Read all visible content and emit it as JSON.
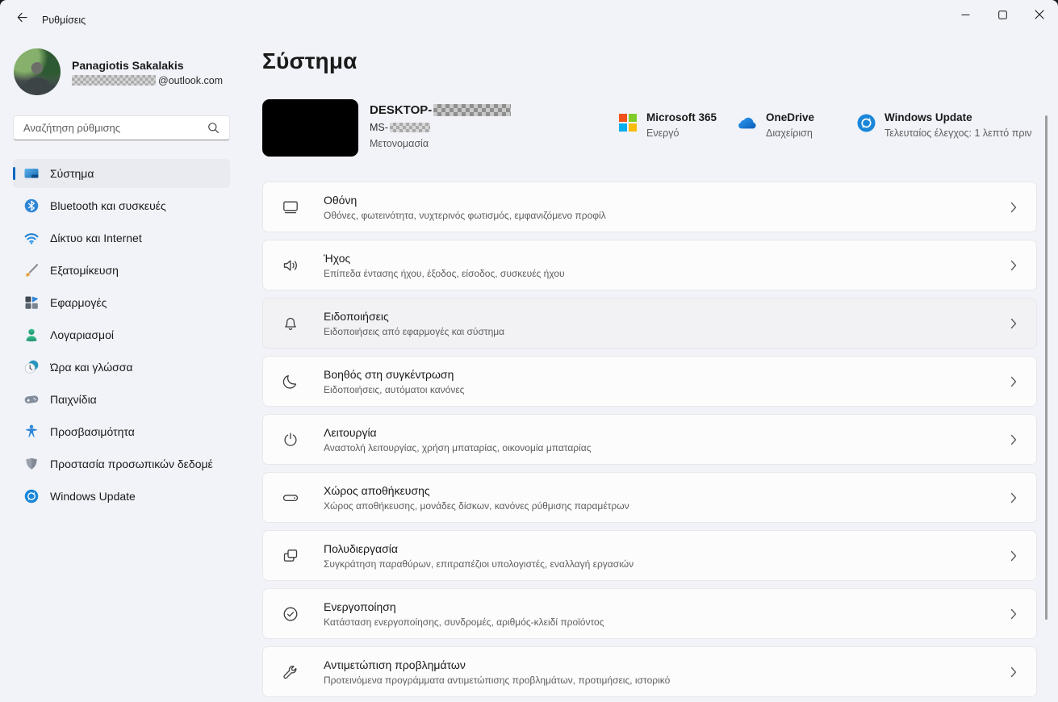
{
  "titlebar": {
    "title": "Ρυθμίσεις"
  },
  "profile": {
    "name": "Panagiotis Sakalakis",
    "email_suffix": "@outlook.com"
  },
  "search": {
    "placeholder": "Αναζήτηση ρύθμισης"
  },
  "sidebar": {
    "items": [
      {
        "label": "Σύστημα",
        "icon": "system-icon",
        "selected": true
      },
      {
        "label": "Bluetooth και συσκευές",
        "icon": "bluetooth-icon",
        "selected": false
      },
      {
        "label": "Δίκτυο και Internet",
        "icon": "network-icon",
        "selected": false
      },
      {
        "label": "Εξατομίκευση",
        "icon": "personalization-icon",
        "selected": false
      },
      {
        "label": "Εφαρμογές",
        "icon": "apps-icon",
        "selected": false
      },
      {
        "label": "Λογαριασμοί",
        "icon": "accounts-icon",
        "selected": false
      },
      {
        "label": "Ώρα και γλώσσα",
        "icon": "time-language-icon",
        "selected": false
      },
      {
        "label": "Παιχνίδια",
        "icon": "gaming-icon",
        "selected": false
      },
      {
        "label": "Προσβασιμότητα",
        "icon": "accessibility-icon",
        "selected": false
      },
      {
        "label": "Προστασία προσωπικών δεδομέ",
        "icon": "privacy-icon",
        "selected": false
      },
      {
        "label": "Windows Update",
        "icon": "windows-update-icon",
        "selected": false
      }
    ]
  },
  "main": {
    "title": "Σύστημα",
    "device": {
      "name_prefix": "DESKTOP-",
      "workgroup_prefix": "MS-",
      "rename_label": "Μετονομασία"
    },
    "quick": [
      {
        "title": "Microsoft 365",
        "status": "Ενεργό"
      },
      {
        "title": "OneDrive",
        "status": "Διαχείριση"
      },
      {
        "title": "Windows Update",
        "status": "Τελευταίος έλεγχος: 1 λεπτό πριν"
      }
    ],
    "cards": [
      {
        "title": "Οθόνη",
        "subtitle": "Οθόνες, φωτεινότητα, νυχτερινός φωτισμός, εμφανιζόμενο προφίλ"
      },
      {
        "title": "Ήχος",
        "subtitle": "Επίπεδα έντασης ήχου, έξοδος, είσοδος, συσκευές ήχου"
      },
      {
        "title": "Ειδοποιήσεις",
        "subtitle": "Ειδοποιήσεις από εφαρμογές και σύστημα"
      },
      {
        "title": "Βοηθός στη συγκέντρωση",
        "subtitle": "Ειδοποιήσεις, αυτόματοι κανόνες"
      },
      {
        "title": "Λειτουργία",
        "subtitle": "Αναστολή λειτουργίας, χρήση μπαταρίας, οικονομία μπαταρίας"
      },
      {
        "title": "Χώρος αποθήκευσης",
        "subtitle": "Χώρος αποθήκευσης, μονάδες δίσκων, κανόνες ρύθμισης παραμέτρων"
      },
      {
        "title": "Πολυδιεργασία",
        "subtitle": "Συγκράτηση παραθύρων, επιτραπέζιοι υπολογιστές, εναλλαγή εργασιών"
      },
      {
        "title": "Ενεργοποίηση",
        "subtitle": "Κατάσταση ενεργοποίησης, συνδρομές, αριθμός-κλειδί προϊόντος"
      },
      {
        "title": "Αντιμετώπιση προβλημάτων",
        "subtitle": "Προτεινόμενα προγράμματα αντιμετώπισης προβλημάτων, προτιμήσεις, ιστορικό"
      }
    ]
  },
  "colors": {
    "accent": "#0067c0",
    "card_bg": "#fcfcfd",
    "window_bg": "#f1f3f9"
  }
}
